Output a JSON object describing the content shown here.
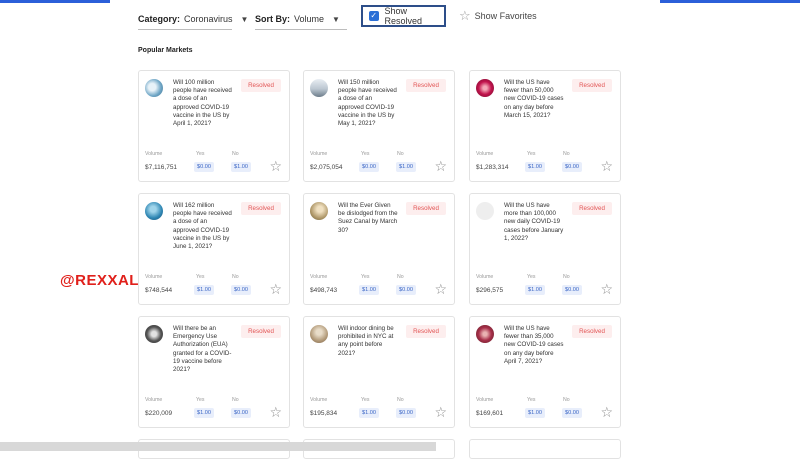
{
  "filters": {
    "category_label": "Category:",
    "category_value": "Coronavirus",
    "sort_label": "Sort By:",
    "sort_value": "Volume",
    "show_resolved_label": "Show Resolved",
    "show_resolved_checked": true,
    "show_favorites_label": "Show Favorites"
  },
  "section_title": "Popular Markets",
  "watermark": "@REXXALO",
  "card_labels": {
    "volume": "Volume",
    "yes": "Yes",
    "no": "No"
  },
  "markets": [
    {
      "question": "Will 100 million people have received a dose of an approved COVID-19 vaccine in the US by April 1, 2021?",
      "status": "Resolved",
      "volume": "$7,116,751",
      "yes": "$0.00",
      "no": "$1.00",
      "icon": "vaccine-image"
    },
    {
      "question": "Will 150 million people have received a dose of an approved COVID-19 vaccine in the US by May 1, 2021?",
      "status": "Resolved",
      "volume": "$2,075,054",
      "yes": "$0.00",
      "no": "$1.00",
      "icon": "vaccine-image"
    },
    {
      "question": "Will the US have fewer than 50,000 new COVID-19 cases on any day before March 15, 2021?",
      "status": "Resolved",
      "volume": "$1,283,314",
      "yes": "$1.00",
      "no": "$0.00",
      "icon": "virus-image"
    },
    {
      "question": "Will 162 million people have received a dose of an approved COVID-19 vaccine in the US by June 1, 2021?",
      "status": "Resolved",
      "volume": "$748,544",
      "yes": "$1.00",
      "no": "$0.00",
      "icon": "vaccine-image"
    },
    {
      "question": "Will the Ever Given be dislodged from the Suez Canal by March 30?",
      "status": "Resolved",
      "volume": "$498,743",
      "yes": "$1.00",
      "no": "$0.00",
      "icon": "ship-image"
    },
    {
      "question": "Will the US have more than 100,000 new daily COVID-19 cases before January 1, 2022?",
      "status": "Resolved",
      "volume": "$296,575",
      "yes": "$1.00",
      "no": "$0.00",
      "icon": "blank-image"
    },
    {
      "question": "Will there be an Emergency Use Authorization (EUA) granted for a COVID-19 vaccine before 2021?",
      "status": "Resolved",
      "volume": "$220,009",
      "yes": "$1.00",
      "no": "$0.00",
      "icon": "vial-image"
    },
    {
      "question": "Will indoor dining be prohibited in NYC at any point before 2021?",
      "status": "Resolved",
      "volume": "$195,834",
      "yes": "$1.00",
      "no": "$0.00",
      "icon": "dining-image"
    },
    {
      "question": "Will the US have fewer than 35,000 new COVID-19 cases on any day before April 7, 2021?",
      "status": "Resolved",
      "volume": "$169,601",
      "yes": "$1.00",
      "no": "$0.00",
      "icon": "virus-image"
    }
  ],
  "colors": {
    "accent": "#2b6fd6",
    "resolved_bg": "#fdeeee",
    "resolved_text": "#e25454",
    "price_bg": "#e8eefb",
    "price_text": "#3b66c6",
    "watermark": "#e0201b"
  }
}
